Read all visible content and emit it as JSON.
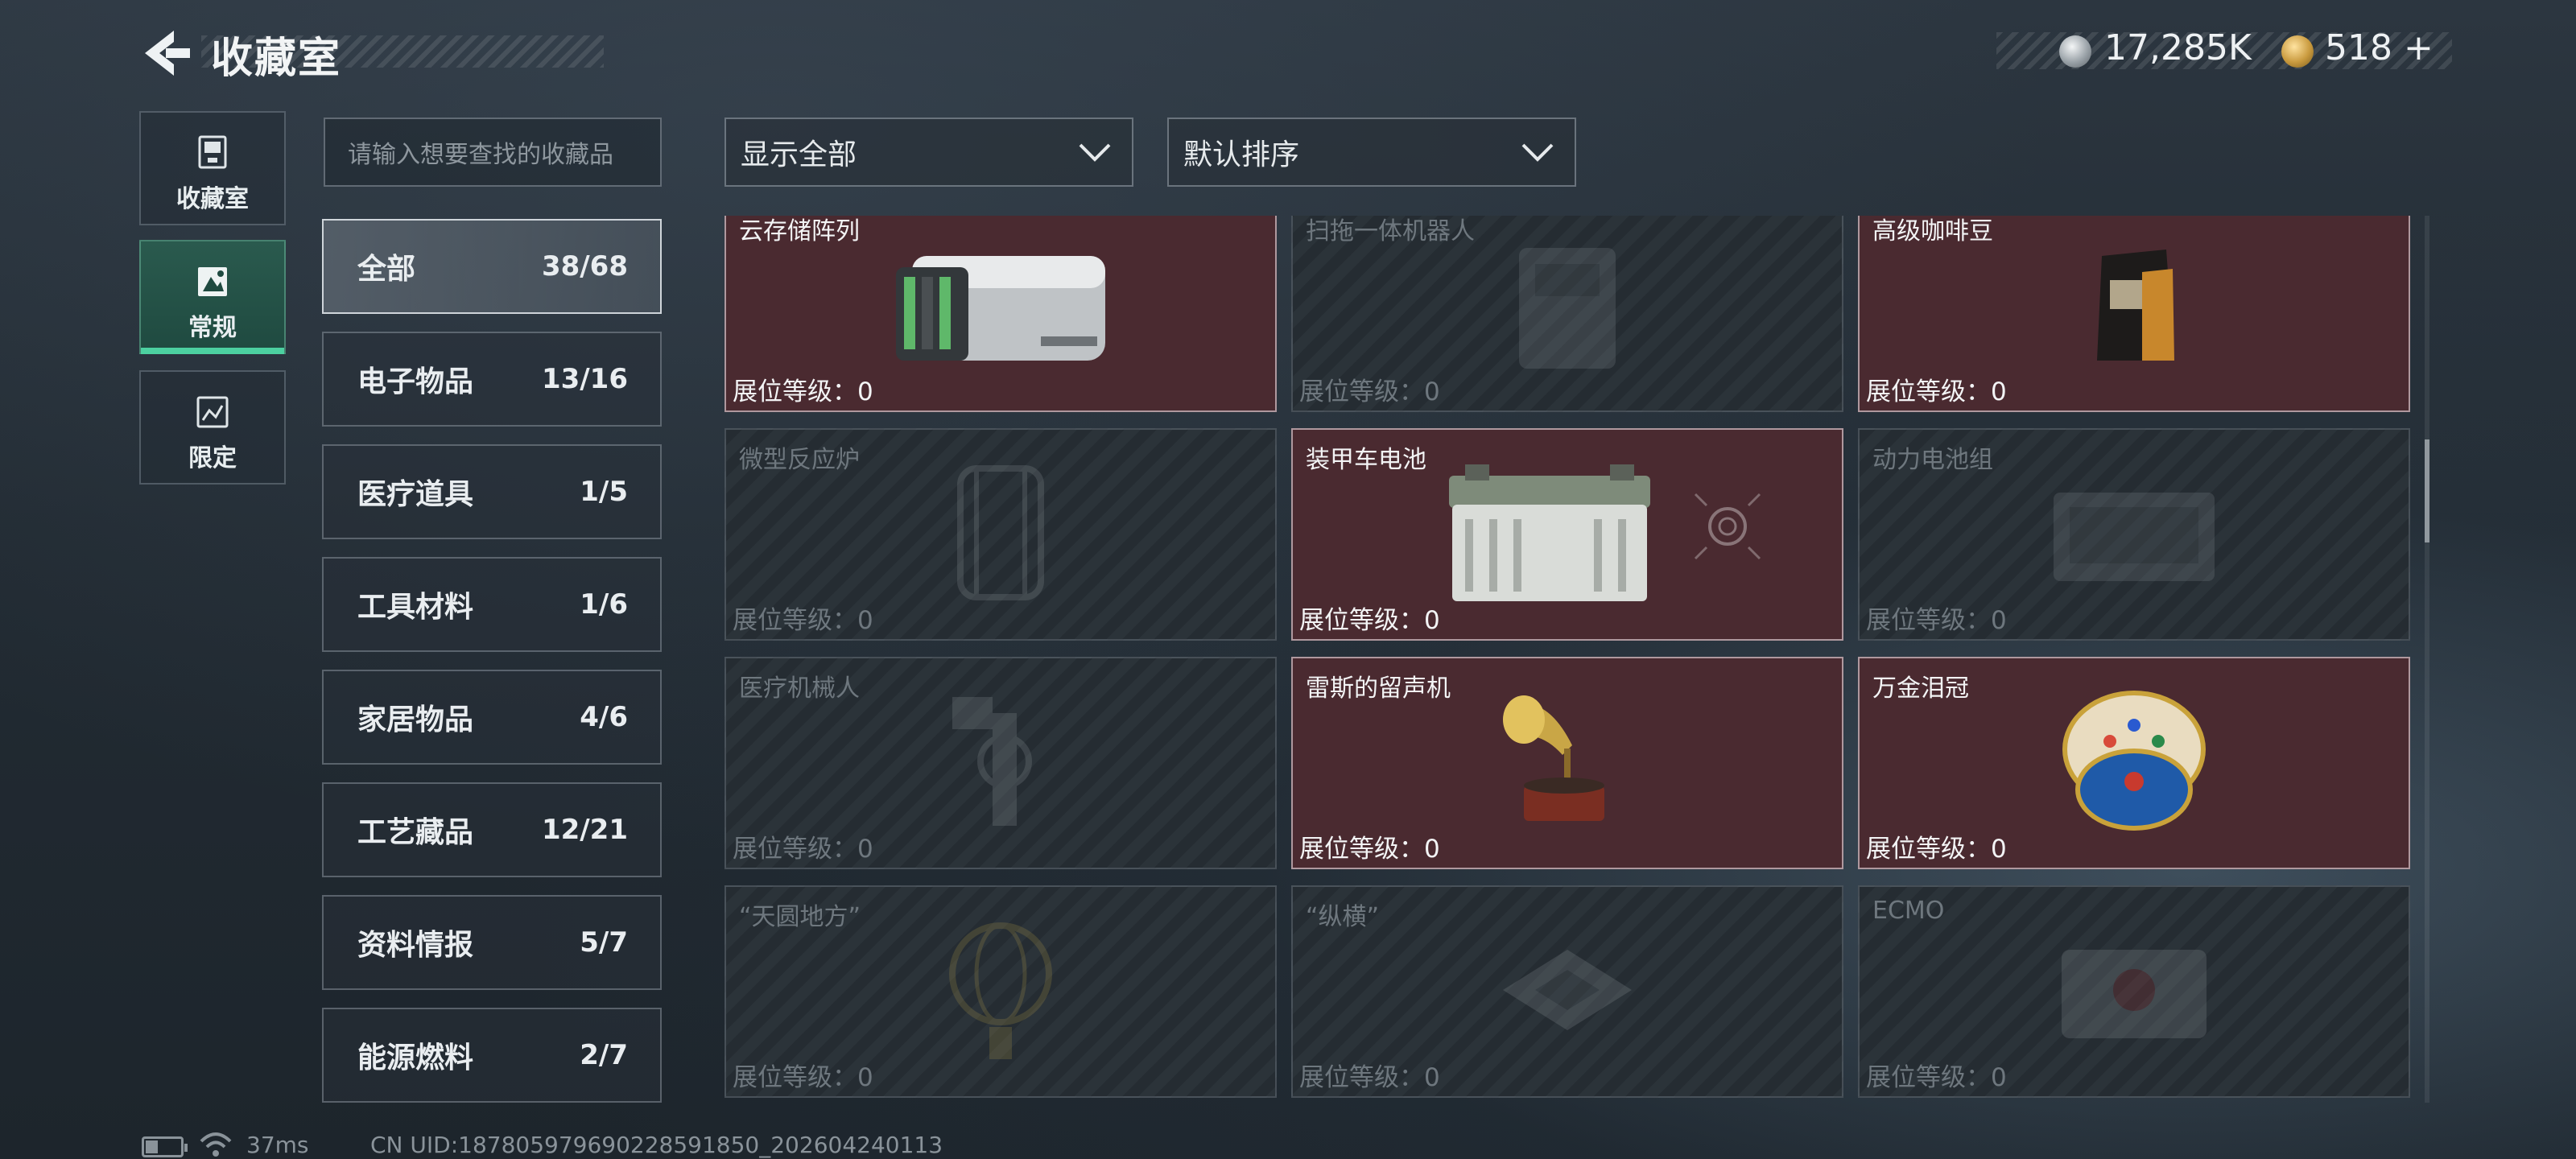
{
  "header": {
    "title": "收藏室",
    "currency": [
      {
        "icon": "silver-coin-icon",
        "value": "17,285K"
      },
      {
        "icon": "gold-coin-icon",
        "value": "518 +"
      }
    ]
  },
  "nav": [
    {
      "label": "收藏室",
      "icon": "collection-box-icon",
      "active": false
    },
    {
      "label": "常规",
      "icon": "regular-card-icon",
      "active": true
    },
    {
      "label": "限定",
      "icon": "limited-card-icon",
      "active": false
    }
  ],
  "search": {
    "placeholder": "请输入想要查找的收藏品"
  },
  "filters": {
    "display": "显示全部",
    "sort": "默认排序"
  },
  "categories": [
    {
      "name": "全部",
      "count": "38/68",
      "active": true
    },
    {
      "name": "电子物品",
      "count": "13/16",
      "active": false
    },
    {
      "name": "医疗道具",
      "count": "1/5",
      "active": false
    },
    {
      "name": "工具材料",
      "count": "1/6",
      "active": false
    },
    {
      "name": "家居物品",
      "count": "4/6",
      "active": false
    },
    {
      "name": "工艺藏品",
      "count": "12/21",
      "active": false
    },
    {
      "name": "资料情报",
      "count": "5/7",
      "active": false
    },
    {
      "name": "能源燃料",
      "count": "2/7",
      "active": false
    }
  ],
  "items": [
    {
      "name": "云存储阵列",
      "level": "展位等级：0",
      "owned": true,
      "art": "storage-array"
    },
    {
      "name": "扫拖一体机器人",
      "level": "展位等级：0",
      "owned": false,
      "art": "robot"
    },
    {
      "name": "高级咖啡豆",
      "level": "展位等级：0",
      "owned": true,
      "art": "coffee"
    },
    {
      "name": "微型反应炉",
      "level": "展位等级：0",
      "owned": false,
      "art": "reactor"
    },
    {
      "name": "装甲车电池",
      "level": "展位等级：0",
      "owned": true,
      "art": "battery"
    },
    {
      "name": "动力电池组",
      "level": "展位等级：0",
      "owned": false,
      "art": "powerpack"
    },
    {
      "name": "医疗机械人",
      "level": "展位等级：0",
      "owned": false,
      "art": "medbot"
    },
    {
      "name": "雷斯的留声机",
      "level": "展位等级：0",
      "owned": true,
      "art": "gramophone"
    },
    {
      "name": "万金泪冠",
      "level": "展位等级：0",
      "owned": true,
      "art": "egg"
    },
    {
      "name": "“天圆地方”",
      "level": "展位等级：0",
      "owned": false,
      "art": "globe"
    },
    {
      "name": "“纵横”",
      "level": "展位等级：0",
      "owned": false,
      "art": "chess"
    },
    {
      "name": "ECMO",
      "level": "展位等级：0",
      "owned": false,
      "art": "ecmo"
    }
  ],
  "status": {
    "ping": "37ms",
    "uid": "CN UID:1878059796902285918​50_202604240113",
    "battery_level": 0.35
  },
  "colors": {
    "owned_card": "#4a2a30",
    "active_nav": "#1f4a40",
    "accent": "#4cd0a0"
  }
}
